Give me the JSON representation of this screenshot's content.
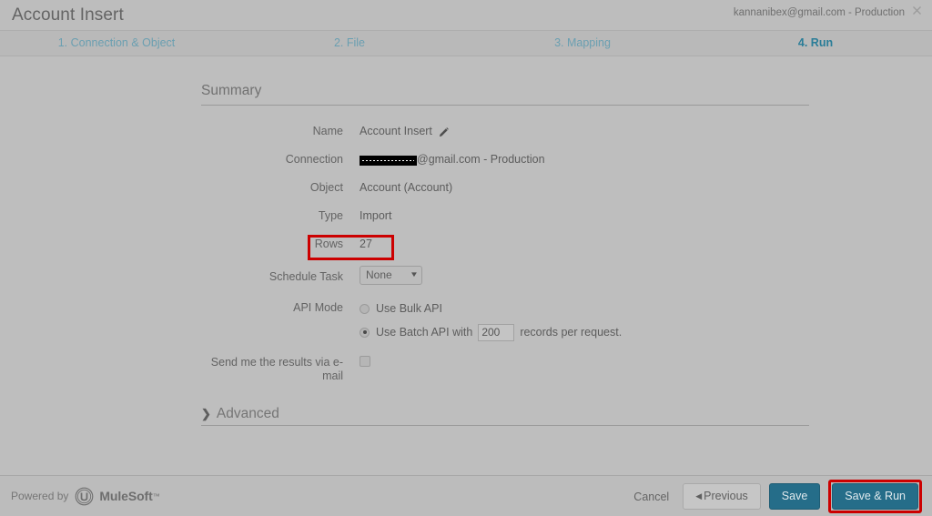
{
  "window": {
    "title": "Account Insert",
    "account_label": "kannanibex@gmail.com - Production",
    "close_icon": "close-icon"
  },
  "steps": [
    {
      "label": "1. Connection & Object",
      "active": false
    },
    {
      "label": "2. File",
      "active": false
    },
    {
      "label": "3. Mapping",
      "active": false
    },
    {
      "label": "4. Run",
      "active": true
    }
  ],
  "summary": {
    "heading": "Summary",
    "fields": {
      "name_label": "Name",
      "name_value": "Account Insert",
      "name_edit_icon": "pencil-edit-icon",
      "connection_label": "Connection",
      "connection_value": "@gmail.com - Production",
      "connection_redacted": true,
      "object_label": "Object",
      "object_value": "Account (Account)",
      "type_label": "Type",
      "type_value": "Import",
      "rows_label": "Rows",
      "rows_value": "27",
      "schedule_label": "Schedule Task",
      "schedule_value": "None",
      "schedule_caret_icon": "chevron-down-icon",
      "api_mode_label": "API Mode",
      "bulk_api_label": "Use Bulk API",
      "bulk_api_selected": false,
      "batch_api_label_before": "Use Batch API with",
      "batch_api_records": "200",
      "batch_api_label_after": "records per request.",
      "batch_api_selected": true,
      "email_results_label": "Send me the results via e-mail",
      "email_results_checked": false
    },
    "advanced_label": "Advanced",
    "advanced_chevron_icon": "chevron-right-icon"
  },
  "footer": {
    "powered_by": "Powered by",
    "brand": "MuleSoft",
    "brand_tm": "™",
    "brand_icon": "mulesoft-logo-icon",
    "cancel_label": "Cancel",
    "previous_label": "Previous",
    "previous_icon": "triangle-left-icon",
    "save_label": "Save",
    "save_run_label": "Save & Run"
  },
  "colors": {
    "accent_button": "#256d89",
    "step_active": "#2a7d98",
    "step_inactive": "#6a9fb1",
    "highlight_border": "#cc0000",
    "page_bg": "#bebebe"
  }
}
